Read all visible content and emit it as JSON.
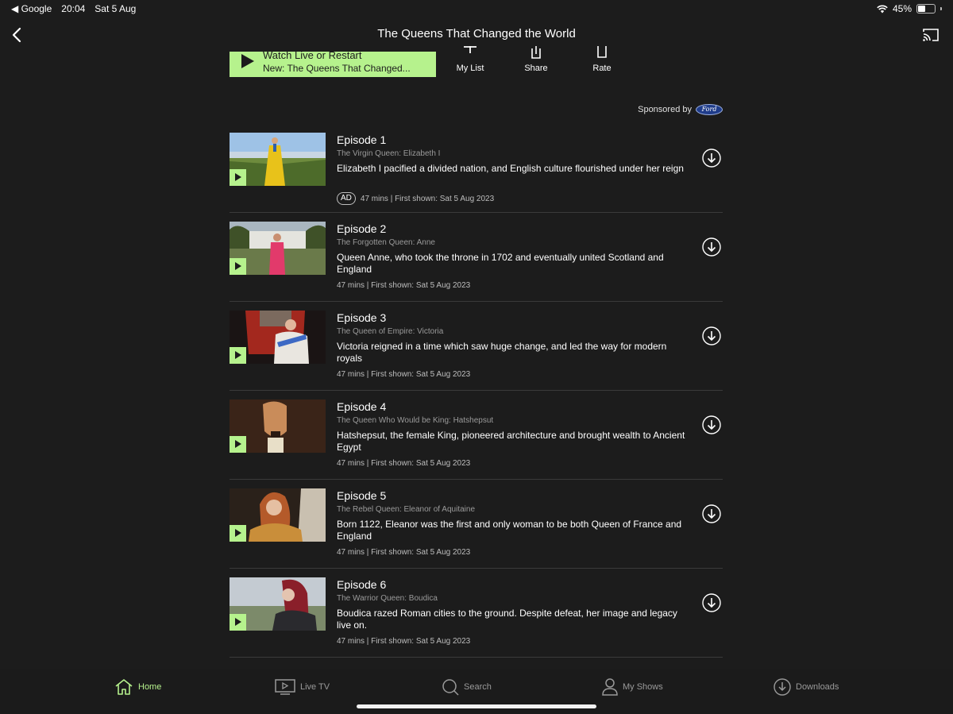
{
  "status": {
    "back_app": "Google",
    "time": "20:04",
    "date": "Sat 5 Aug",
    "battery": "45%"
  },
  "nav": {
    "title": "The Queens That Changed the World"
  },
  "watch": {
    "line1": "Watch Live or Restart",
    "line2": "New: The Queens That Changed..."
  },
  "actions": {
    "my_list": "My List",
    "share": "Share",
    "rate": "Rate"
  },
  "sponsor": {
    "label": "Sponsored by",
    "brand": "Ford"
  },
  "episodes": [
    {
      "title": "Episode 1",
      "subtitle": "The Virgin Queen: Elizabeth I",
      "description": "Elizabeth I pacified a divided nation, and English culture flourished under her reign",
      "badge": "AD",
      "meta": "47 mins | First shown: Sat 5 Aug 2023"
    },
    {
      "title": "Episode 2",
      "subtitle": "The Forgotten Queen: Anne",
      "description": "Queen Anne, who took the throne in 1702 and eventually united Scotland and England",
      "badge": "",
      "meta": "47 mins | First shown: Sat 5 Aug 2023"
    },
    {
      "title": "Episode 3",
      "subtitle": "The Queen of Empire: Victoria",
      "description": "Victoria reigned in a time which saw huge change, and led the way for modern royals",
      "badge": "",
      "meta": "47 mins | First shown: Sat 5 Aug 2023"
    },
    {
      "title": "Episode 4",
      "subtitle": "The Queen Who Would be King: Hatshepsut",
      "description": "Hatshepsut, the female King, pioneered architecture and brought wealth to Ancient Egypt",
      "badge": "",
      "meta": "47 mins | First shown: Sat 5 Aug 2023"
    },
    {
      "title": "Episode 5",
      "subtitle": "The Rebel Queen: Eleanor of Aquitaine",
      "description": "Born 1122, Eleanor was the first and only woman to be both Queen of France and England",
      "badge": "",
      "meta": "47 mins | First shown: Sat 5 Aug 2023"
    },
    {
      "title": "Episode 6",
      "subtitle": "The Warrior Queen: Boudica",
      "description": "Boudica razed Roman cities to the ground. Despite defeat, her image and legacy live on.",
      "badge": "",
      "meta": "47 mins | First shown: Sat 5 Aug 2023"
    }
  ],
  "tabs": {
    "home": "Home",
    "live_tv": "Live TV",
    "search": "Search",
    "my_shows": "My Shows",
    "downloads": "Downloads"
  },
  "colors": {
    "accent": "#b6f28d",
    "background": "#1c1c1c"
  }
}
